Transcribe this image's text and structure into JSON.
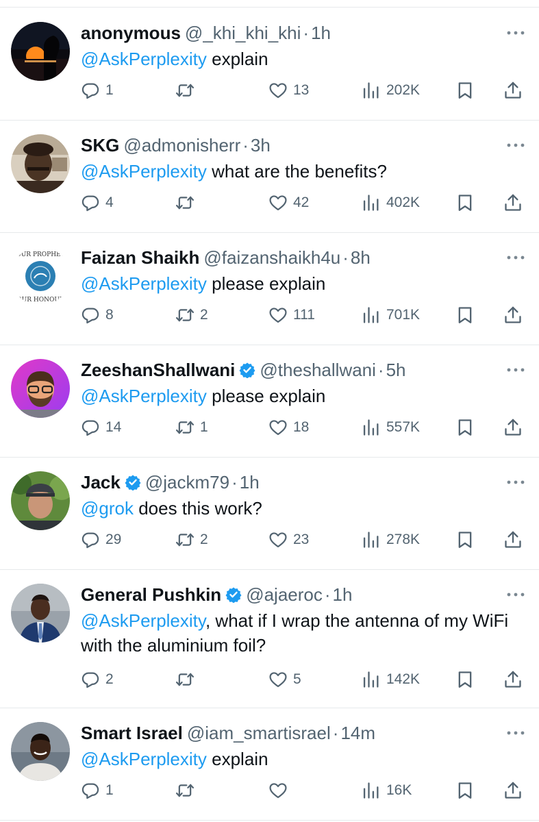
{
  "colors": {
    "accent": "#1d9bf0",
    "text": "#0f1419",
    "muted": "#536471",
    "divider": "#e6e9eb"
  },
  "icons": {
    "reply": "reply-icon",
    "retweet": "retweet-icon",
    "like": "like-icon",
    "views": "views-icon",
    "bookmark": "bookmark-icon",
    "share": "share-icon",
    "more": "more-icon",
    "verified": "verified-badge-icon"
  },
  "tweets": [
    {
      "name": "anonymous",
      "verified": false,
      "handle": "@_khi_khi_khi",
      "dot": "·",
      "time": "1h",
      "mention": "@AskPerplexity",
      "text": " explain",
      "replies": "1",
      "retweets": "",
      "likes": "13",
      "views": "202K"
    },
    {
      "name": "SKG",
      "verified": false,
      "handle": "@admonisherr",
      "dot": "·",
      "time": "3h",
      "mention": "@AskPerplexity",
      "text": " what are the benefits?",
      "replies": "4",
      "retweets": "",
      "likes": "42",
      "views": "402K"
    },
    {
      "name": "Faizan Shaikh",
      "verified": false,
      "handle": "@faizanshaikh4u",
      "dot": "·",
      "time": "8h",
      "mention": "@AskPerplexity",
      "text": " please explain",
      "replies": "8",
      "retweets": "2",
      "likes": "111",
      "views": "701K",
      "avatar_text_top": "OUR PROPHET",
      "avatar_text_bottom": "OUR HONOUR"
    },
    {
      "name": "ZeeshanShallwani",
      "verified": true,
      "handle": "@theshallwani",
      "dot": "·",
      "time": "5h",
      "mention": "@AskPerplexity",
      "text": " please explain",
      "replies": "14",
      "retweets": "1",
      "likes": "18",
      "views": "557K"
    },
    {
      "name": "Jack",
      "verified": true,
      "handle": "@jackm79",
      "dot": "·",
      "time": "1h",
      "mention": "@grok",
      "text": " does this work?",
      "replies": "29",
      "retweets": "2",
      "likes": "23",
      "views": "278K"
    },
    {
      "name": "General Pushkin",
      "verified": true,
      "handle": "@ajaeroc",
      "dot": "·",
      "time": "1h",
      "mention": "@AskPerplexity",
      "text": ", what if I wrap the antenna of my WiFi with the aluminium foil?",
      "replies": "2",
      "retweets": "",
      "likes": "5",
      "views": "142K"
    },
    {
      "name": "Smart Israel",
      "verified": false,
      "handle": "@iam_smartisrael",
      "dot": "·",
      "time": "14m",
      "mention": "@AskPerplexity",
      "text": " explain",
      "replies": "1",
      "retweets": "",
      "likes": "",
      "views": "16K"
    }
  ]
}
